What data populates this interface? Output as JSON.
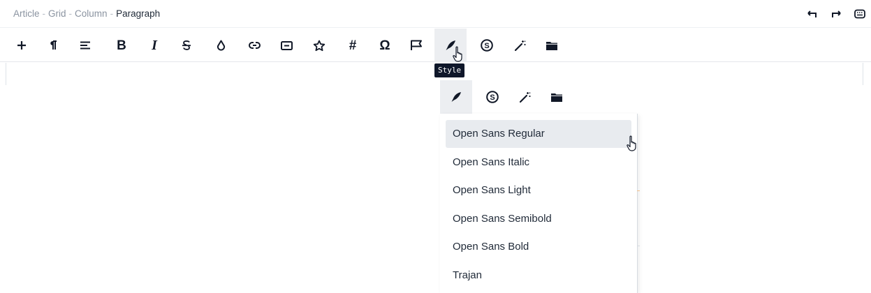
{
  "breadcrumb": {
    "items": [
      "Article",
      "Grid",
      "Column"
    ],
    "current": "Paragraph",
    "separator": "-"
  },
  "topbar_actions": [
    {
      "name": "undo",
      "icon": "undo-arrow-icon"
    },
    {
      "name": "redo",
      "icon": "redo-arrow-icon"
    },
    {
      "name": "keyboard",
      "icon": "keyboard-icon"
    }
  ],
  "toolbar": {
    "bold_label": "B",
    "italic_label": "I",
    "hash_label": "#",
    "omega_label": "Ω",
    "buttons": [
      {
        "name": "add",
        "icon": "plus-icon"
      },
      {
        "name": "paragraph",
        "icon": "pilcrow-icon"
      },
      {
        "name": "align",
        "icon": "align-icon"
      },
      {
        "name": "bold",
        "icon": "bold-icon"
      },
      {
        "name": "italic",
        "icon": "italic-icon"
      },
      {
        "name": "strikethrough",
        "icon": "strikethrough-icon"
      },
      {
        "name": "color",
        "icon": "droplet-icon"
      },
      {
        "name": "link",
        "icon": "link-icon"
      },
      {
        "name": "button",
        "icon": "button-icon"
      },
      {
        "name": "favorite",
        "icon": "star-icon"
      },
      {
        "name": "hashtag",
        "icon": "hash-icon"
      },
      {
        "name": "special-characters",
        "icon": "omega-icon"
      },
      {
        "name": "flag",
        "icon": "flag-icon"
      },
      {
        "name": "style",
        "icon": "feather-icon",
        "active": true
      },
      {
        "name": "symbol",
        "icon": "s-circle-icon"
      },
      {
        "name": "magic",
        "icon": "magic-wand-icon"
      },
      {
        "name": "folder",
        "icon": "folder-icon"
      }
    ]
  },
  "tooltip": {
    "text": "Style"
  },
  "style_popover": {
    "tabs": [
      {
        "name": "style",
        "icon": "feather-icon",
        "active": true
      },
      {
        "name": "symbol",
        "icon": "s-circle-icon"
      },
      {
        "name": "magic",
        "icon": "magic-wand-icon"
      },
      {
        "name": "folder",
        "icon": "folder-icon"
      }
    ],
    "fonts": [
      {
        "label": "Open Sans Regular",
        "hovered": true
      },
      {
        "label": "Open Sans Italic"
      },
      {
        "label": "Open Sans Light"
      },
      {
        "label": "Open Sans Semibold"
      },
      {
        "label": "Open Sans Bold"
      },
      {
        "label": "Trajan"
      }
    ]
  },
  "colors": {
    "active_bg": "#eceef1",
    "hover_bg": "#e8ebef",
    "tooltip_bg": "#0f172a",
    "breadcrumb_muted": "#8a93a0"
  }
}
